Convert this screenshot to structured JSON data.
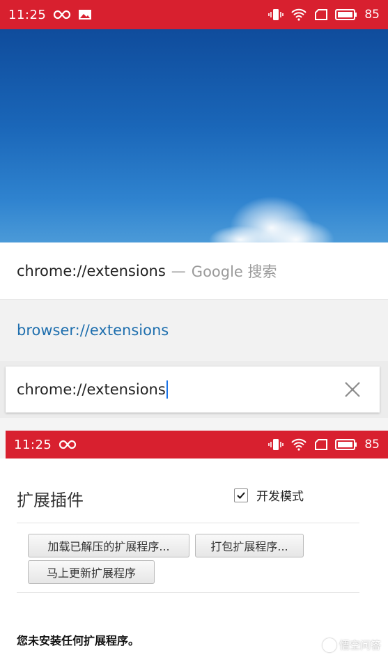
{
  "status_bar_top": {
    "time": "11:25",
    "battery": "85"
  },
  "omnibox": {
    "suggestion_1": {
      "text": "chrome://extensions",
      "dash": "—",
      "engine": "Google 搜索"
    },
    "suggestion_2": {
      "text": "browser://extensions"
    },
    "input_value": "chrome://extensions"
  },
  "status_bar_bottom": {
    "time": "11:25",
    "battery": "85"
  },
  "extensions_page": {
    "title": "扩展插件",
    "developer_mode_label": "开发模式",
    "developer_mode_checked": true,
    "buttons": {
      "load_unpacked": "加载已解压的扩展程序...",
      "pack": "打包扩展程序...",
      "update_now": "马上更新扩展程序"
    },
    "empty_message": "您未安装任何扩展程序。"
  },
  "watermark": "悟空问答",
  "colors": {
    "status_bar": "#d8202f",
    "link_blue": "#1f6fae",
    "sky_top": "#0f4c9c"
  }
}
